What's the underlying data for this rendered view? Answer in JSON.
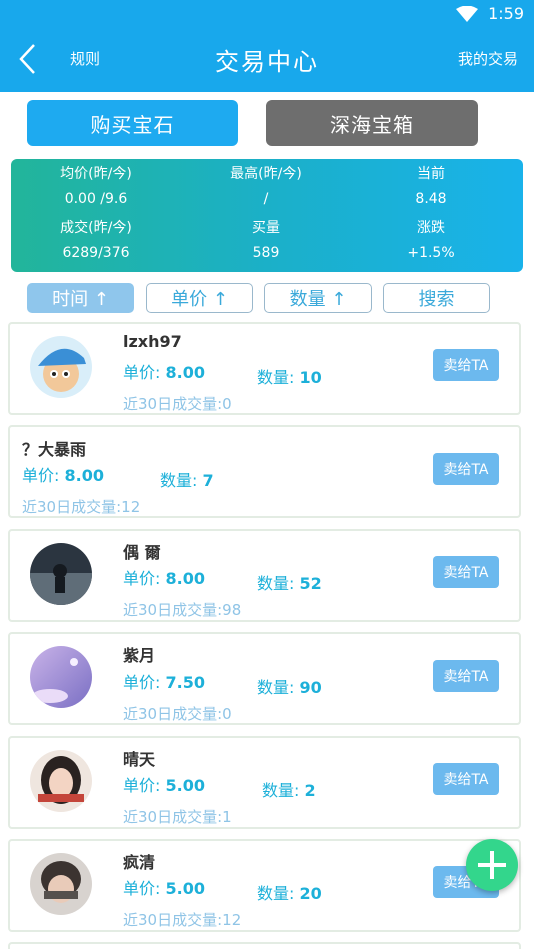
{
  "status_bar": {
    "time": "1:59"
  },
  "header": {
    "back_icon": "chevron-left-icon",
    "rules": "规则",
    "title": "交易中心",
    "my_trades": "我的交易"
  },
  "tabs": {
    "buy": "购买宝石",
    "chest": "深海宝箱"
  },
  "stats": {
    "avg_label": "均价(昨/今)",
    "avg_value": "0.00 /9.6",
    "high_label": "最高(昨/今)",
    "high_value": "/",
    "current_label": "当前",
    "current_value": "8.48",
    "deal_label": "成交(昨/今)",
    "deal_value": "6289/376",
    "buy_label": "买量",
    "buy_value": "589",
    "change_label": "涨跌",
    "change_value": "+1.5%"
  },
  "sort": {
    "time": "时间 ↑",
    "price": "单价 ↑",
    "qty": "数量 ↑",
    "search": "搜索"
  },
  "labels": {
    "price": "单价: ",
    "qty": "数量: ",
    "vol_prefix": "近30日成交量:",
    "sell": "卖给TA"
  },
  "listings": [
    {
      "name": "lzxh97",
      "price": "8.00",
      "qty": "10",
      "vol": "0"
    },
    {
      "name": "？大暴雨",
      "price": "8.00",
      "qty": "7",
      "vol": "12"
    },
    {
      "name": "偶 爾",
      "price": "8.00",
      "qty": "52",
      "vol": "98"
    },
    {
      "name": "紫月",
      "price": "7.50",
      "qty": "90",
      "vol": "0"
    },
    {
      "name": "晴天",
      "price": "5.00",
      "qty": "2",
      "vol": "1"
    },
    {
      "name": "疯清",
      "price": "5.00",
      "qty": "20",
      "vol": "12"
    }
  ],
  "colors": {
    "primary": "#18a8ec",
    "accent_text": "#1db0d9",
    "fab": "#33d68c"
  }
}
